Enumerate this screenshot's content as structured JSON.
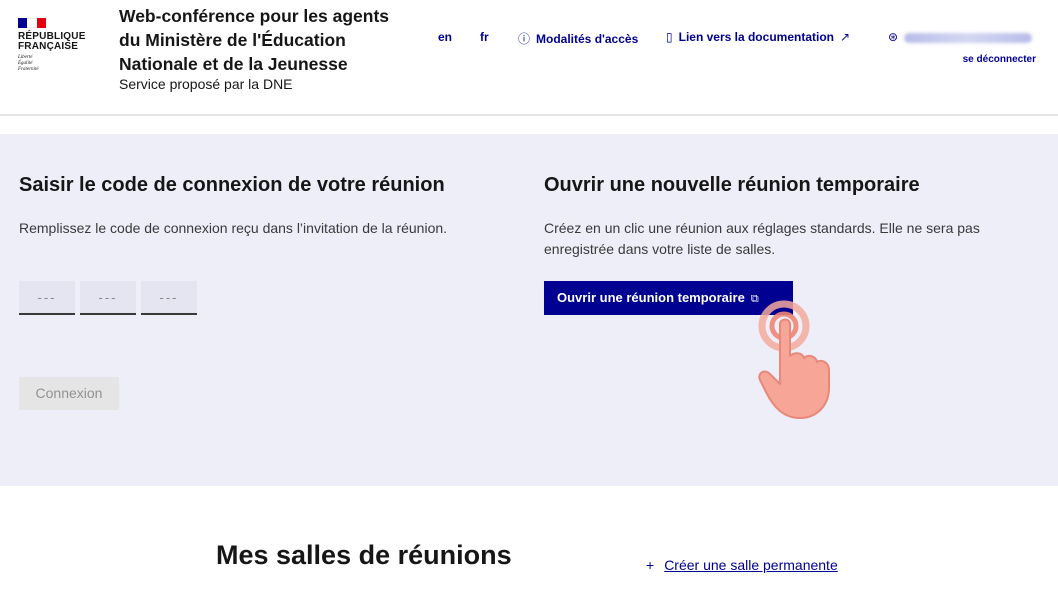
{
  "header": {
    "rf_name": "RÉPUBLIQUE\nFRANÇAISE",
    "rf_motto": "Liberté\nÉgalité\nFraternité",
    "service_title": "Web-conférence pour les agents du Ministère de l'Éducation Nationale et de la Jeunesse",
    "service_tagline": "Service proposé par la DNE",
    "nav": {
      "lang_en": "en",
      "lang_fr": "fr",
      "access_label": "Modalités d'accès",
      "docs_label": "Lien vers la documentation",
      "logout_label": "se déconnecter"
    }
  },
  "join": {
    "title": "Saisir le code de connexion de votre réunion",
    "description": "Remplissez le code de connexion reçu dans l’invitation de la réunion.",
    "code_placeholder": "---",
    "connect_label": "Connexion"
  },
  "quick_meeting": {
    "title": "Ouvrir une nouvelle réunion temporaire",
    "description": "Créez en un clic une réunion aux réglages standards. Elle ne sera pas enregistrée dans votre liste de salles.",
    "button_label": "Ouvrir une réunion temporaire"
  },
  "rooms": {
    "title": "Mes salles de réunions",
    "create_label": "Créer une salle permanente"
  },
  "colors": {
    "primary": "#000091",
    "hero_bg": "#eeeef9",
    "flag_red": "#e1000f"
  },
  "icons": [
    "info-icon",
    "book-icon",
    "external-link-icon",
    "user-icon",
    "video-icon",
    "plus-icon",
    "hand-pointer-icon"
  ]
}
